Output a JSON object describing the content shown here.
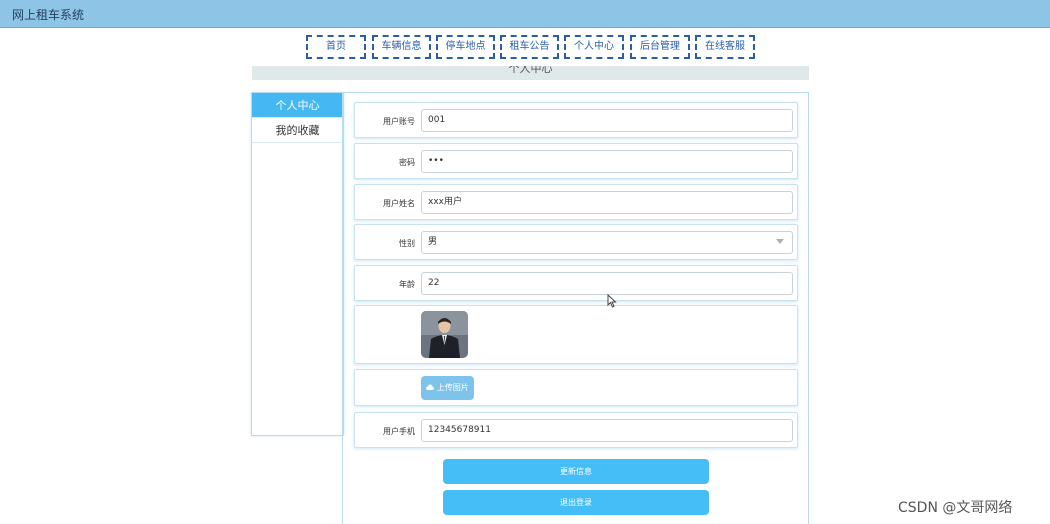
{
  "header": {
    "title": "网上租车系统"
  },
  "nav": [
    "首页",
    "车辆信息",
    "停车地点",
    "租车公告",
    "个人中心",
    "后台管理",
    "在线客服"
  ],
  "section_title": "个人中心",
  "sidebar": {
    "items": [
      {
        "label": "个人中心",
        "active": true
      },
      {
        "label": "我的收藏",
        "active": false
      }
    ]
  },
  "form": {
    "account": {
      "label": "用户账号",
      "value": "001"
    },
    "password": {
      "label": "密码",
      "value": "•••"
    },
    "name": {
      "label": "用户姓名",
      "value": "xxx用户"
    },
    "gender": {
      "label": "性别",
      "value": "男"
    },
    "age": {
      "label": "年龄",
      "value": "22"
    },
    "upload_label": "上传图片",
    "phone": {
      "label": "用户手机",
      "value": "12345678911"
    }
  },
  "buttons": {
    "update": "更新信息",
    "logout": "退出登录"
  },
  "watermark": "CSDN @文哥网络"
}
